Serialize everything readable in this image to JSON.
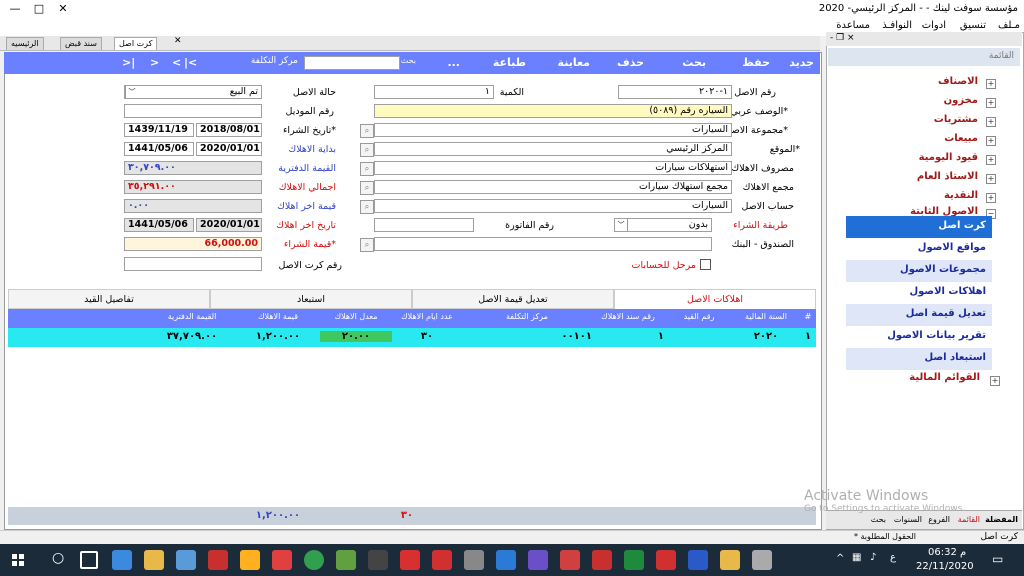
{
  "window": {
    "title": "مؤسسة سوفت لينك  -  - المركز الرئيسي- 2020",
    "minimize": "—",
    "maximize": "□",
    "close": "✕"
  },
  "menu": {
    "items": [
      "مـلف",
      "تنسيق",
      "ادوات",
      "النوافـذ",
      "مساعدة"
    ],
    "mdi_controls": "- ❐ ×"
  },
  "tabs": [
    {
      "label": "كرت اصل",
      "close": "✕"
    },
    {
      "label": "سند قبض"
    },
    {
      "label": "الرئيسيه"
    }
  ],
  "toolbar": {
    "actions": [
      "جديد",
      "حفظ",
      "بحث",
      "حذف",
      "معاينة",
      "طباعة",
      "..."
    ],
    "search_label": "بحث",
    "cost_center_label": "مركز التكلفة",
    "nav": [
      "|<",
      "<",
      ">",
      ">|",
      ">|"
    ]
  },
  "form": {
    "asset_no_label": "رقم الاصل",
    "asset_no": "١-٢٠٢٠",
    "quantity_label": "الكمية",
    "quantity": "١",
    "status_label": "حالة الاصل",
    "status": "تم البيع",
    "model_label": "رقم الموديل",
    "description_label": "*الوصف عربي",
    "description": "السياره رقم (٥٠٨٩)",
    "group_label": "*مجموعة الاصل",
    "group": "السيارات",
    "location_label": "*الموقع",
    "location": "المركز الرئيسي",
    "depr_expense_label": "مصروف الاهلاك",
    "depr_expense": "استهلاكات سيارات",
    "depr_total_label": "مجمع الاهلاك",
    "depr_total": "مجمع استهلاك سيارات",
    "asset_account_label": "حساب الاصل",
    "asset_account": "السيارات",
    "purchase_method_label": "طريقة الشراء",
    "purchase_method": "بدون",
    "invoice_no_label": "رقم الفاتورة",
    "cashbox_label": "الصندوق - البنك",
    "posted_label": "مرحل للحسابات",
    "asset_card_no_label": "رقم كرت الاصل",
    "purchase_date_label": "*تاريخ الشراء",
    "purchase_date_g": "2018/08/01",
    "purchase_date_h": "1439/11/19",
    "depr_start_label": "بداية الاهلاك",
    "depr_start_g": "2020/01/01",
    "depr_start_h": "1441/05/06",
    "book_value_label": "القيمة الدفترية",
    "book_value": "٣٠,٧٠٩.٠٠",
    "total_depr_label": "اجمالي الاهلاك",
    "total_depr": "٣٥,٢٩١.٠٠",
    "last_depr_value_label": "قيمة اخر اهلاك",
    "last_depr_value": "٠.٠٠",
    "last_depr_date_label": "تاريخ اخر اهلاك",
    "last_depr_date_g": "2020/01/01",
    "last_depr_date_h": "1441/05/06",
    "purchase_value_label": "*قيمة الشراء",
    "purchase_value": "66,000.00"
  },
  "grid_tabs": [
    "اهلاكات الاصل",
    "تعديل قيمة الاصل",
    "استبعاد",
    "تفاصيل القيد"
  ],
  "grid": {
    "headers": [
      "#",
      "السنة المالية",
      "رقم القيد",
      "رقم سند الاهلاك",
      "مركز التكلفة",
      "عدد ايام الاهلاك",
      "معدل الاهلاك",
      "قيمة الاهلاك",
      "القيمة الدفترية"
    ],
    "row": [
      "١",
      "٢٠٢٠",
      "",
      "١",
      "٠٠١٠١",
      "٣٠",
      "٢٠.٠٠",
      "١,٢٠٠.٠٠",
      "٣٧,٧٠٩.٠٠"
    ],
    "footer_days": "٣٠",
    "footer_value": "١,٢٠٠.٠٠"
  },
  "side": {
    "title": "القائمة",
    "top_items": [
      "الاصناف",
      "مخزون",
      "مشتريات",
      "مبيعات",
      "قيود اليومية",
      "الاستاذ العام",
      "النقدية",
      "الاصول الثابتة"
    ],
    "sub_items": [
      "كرت اصل",
      "مواقع الاصول",
      "مجموعات الاصول",
      "اهلاكات الاصول",
      "تعديل قيمة اصل",
      "تقرير بيانات الاصول",
      "استبعاد اصل"
    ],
    "bottom_item": "القوائم المالية",
    "tabs": [
      "المفضلة",
      "القائمة",
      "الفروع",
      "السنوات",
      "بحث"
    ]
  },
  "status": {
    "left_text": "كرت اصل",
    "hint": "* الحقول المطلوبة"
  },
  "watermark": {
    "title": "Activate Windows",
    "subtitle": "Go to Settings to activate Windows."
  },
  "taskbar": {
    "time": "06:32 م",
    "date": "22/11/2020",
    "lang": "ع"
  },
  "colors": {
    "toolbar": "#6a80ff",
    "row_highlight": "#28e8f0",
    "selected_tree": "#1f6fd6"
  }
}
